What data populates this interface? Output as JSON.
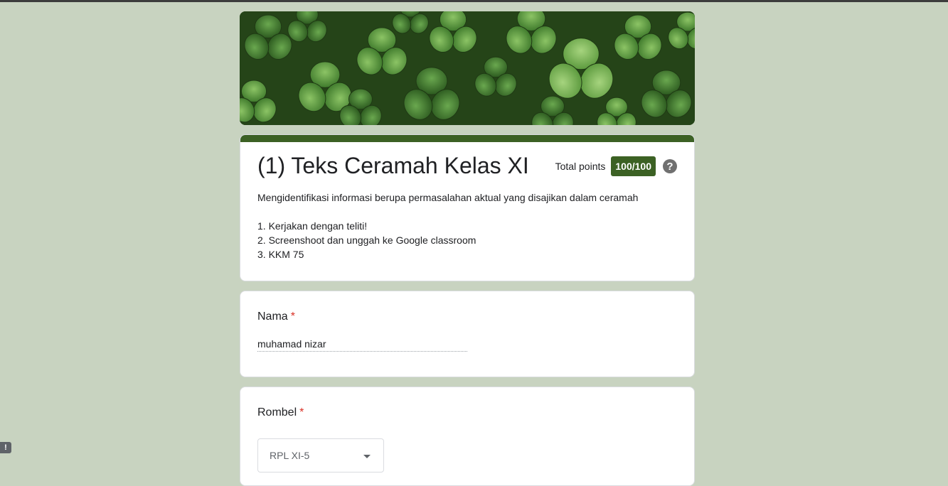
{
  "colors": {
    "page_background": "#c8d3c0",
    "theme": "#3c6124"
  },
  "banner": {
    "icon": "clover-leaves-image"
  },
  "form": {
    "title": "(1) Teks Ceramah Kelas XI",
    "points_label": "Total points",
    "points_value": "100/100",
    "help_icon": "?",
    "description": {
      "intro": "Mengidentifikasi informasi berupa permasalahan aktual yang disajikan dalam ceramah",
      "items": [
        "1. Kerjakan dengan teliti!",
        "2. Screenshoot dan unggah ke Google classroom",
        "3. KKM 75"
      ]
    }
  },
  "questions": [
    {
      "label": "Nama",
      "required_mark": "*",
      "answer": "muhamad nizar"
    },
    {
      "label": "Rombel",
      "required_mark": "*",
      "selected": "RPL XI-5"
    }
  ],
  "feedback_button": "!"
}
